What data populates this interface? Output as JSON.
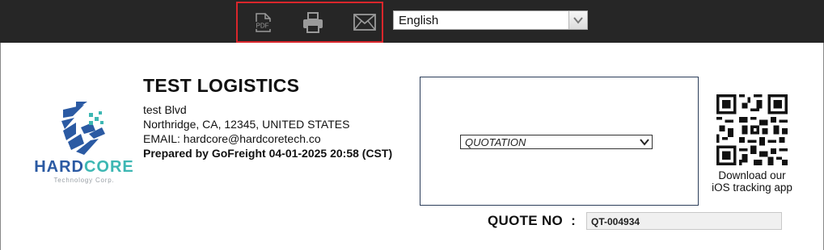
{
  "toolbar": {
    "icons": [
      "pdf-icon",
      "printer-icon",
      "mail-icon"
    ],
    "pdf_label": "PDF",
    "highlight_color": "#d9262b"
  },
  "language": {
    "selected": "English"
  },
  "company": {
    "logo_text_1": "HARDCORE",
    "logo_text_2": "Technology Corp.",
    "name": "TEST LOGISTICS",
    "address_line1": "test Blvd",
    "address_line2": "Northridge, CA, 12345, UNITED STATES",
    "email_line": "EMAIL: hardcore@hardcoretech.co",
    "prepared_by": "Prepared by GoFreight 04-01-2025 20:58 (CST)"
  },
  "document": {
    "type_selected": "QUOTATION"
  },
  "qr": {
    "caption_line1": "Download our",
    "caption_line2": "iOS tracking app"
  },
  "quote": {
    "label": "QUOTE NO  :",
    "number": "QT-004934"
  },
  "colors": {
    "topbar": "#262626",
    "logo_blue": "#2b5aa3",
    "logo_teal": "#3db7b3"
  }
}
